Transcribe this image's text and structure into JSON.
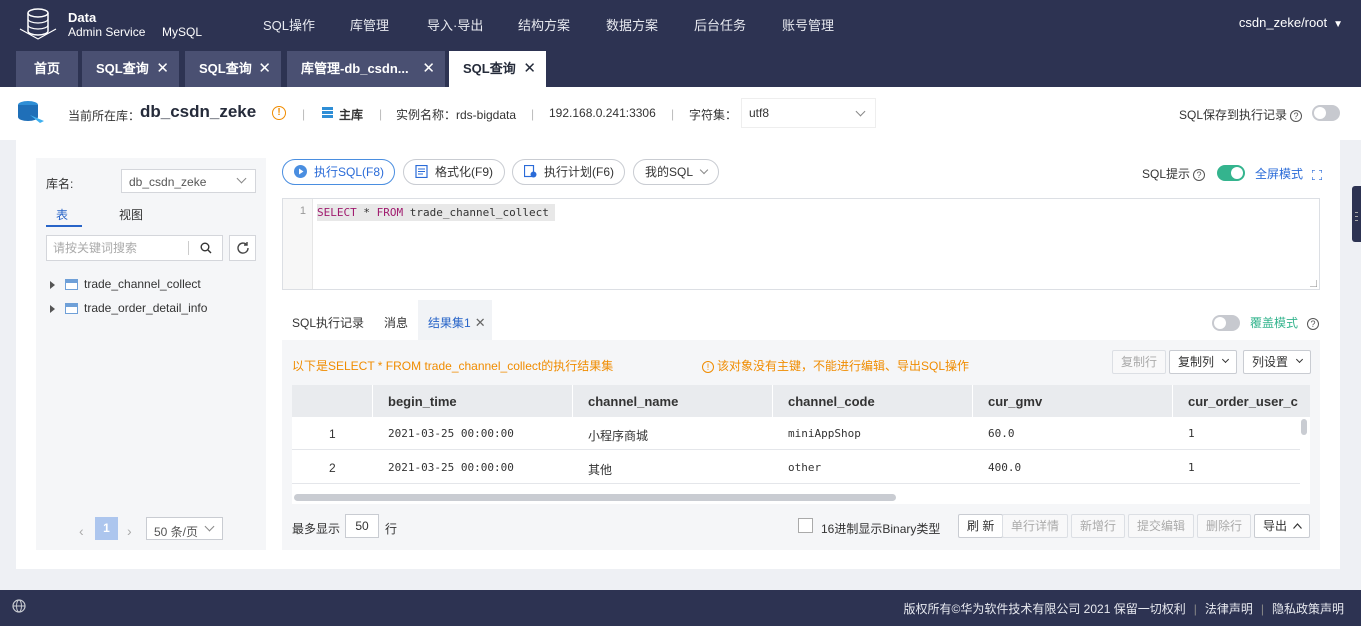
{
  "brand": {
    "line1": "Data",
    "line2": "Admin Service",
    "product": "MySQL"
  },
  "nav": {
    "items": [
      "SQL操作",
      "库管理",
      "导入·导出",
      "结构方案",
      "数据方案",
      "后台任务",
      "账号管理"
    ],
    "user": "csdn_zeke/root"
  },
  "tabs": [
    {
      "label": "首页"
    },
    {
      "label": "SQL查询",
      "close": "✕"
    },
    {
      "label": "SQL查询",
      "close": "✕"
    },
    {
      "label": "库管理-db_csdn...",
      "close": "✕"
    },
    {
      "label": "SQL查询",
      "close": "✕"
    }
  ],
  "info": {
    "current_label": "当前所在库：",
    "db_name": "db_csdn_zeke",
    "role": "主库",
    "instance": "实例名称：rds-bigdata",
    "address": "192.168.0.241:3306",
    "charset_label": "字符集：",
    "charset_value": "utf8",
    "save_label": "SQL保存到执行记录"
  },
  "left": {
    "lib_label": "库名:",
    "lib_value": "db_csdn_zeke",
    "tab_tables": "表",
    "tab_views": "视图",
    "search_placeholder": "请按关键词搜索",
    "tables": [
      "trade_channel_collect",
      "trade_order_detail_info"
    ],
    "page": "1",
    "page_size": "50 条/页"
  },
  "toolbar": {
    "run": "执行SQL(F8)",
    "format": "格式化(F9)",
    "plan": "执行计划(F6)",
    "mysql": "我的SQL",
    "sql_tip": "SQL提示",
    "fullscreen": "全屏模式"
  },
  "editor": {
    "line": "1",
    "kw1": "SELECT",
    "mid": " * ",
    "kw2": "FROM",
    "rest": " trade_channel_collect"
  },
  "result_tabs": {
    "history": "SQL执行记录",
    "messages": "消息",
    "result": "结果集1",
    "cover": "覆盖模式"
  },
  "result": {
    "message": "以下是SELECT * FROM trade_channel_collect的执行结果集",
    "warning": "该对象没有主键，不能进行编辑、导出SQL操作",
    "btn_copy_row": "复制行",
    "btn_copy_col": "复制列",
    "btn_col_settings": "列设置",
    "columns": [
      "begin_time",
      "channel_name",
      "channel_code",
      "cur_gmv",
      "cur_order_user_c"
    ],
    "rows": [
      {
        "n": "1",
        "begin_time": "2021-03-25 00:00:00",
        "channel_name": "小程序商城",
        "channel_code": "miniAppShop",
        "cur_gmv": "60.0",
        "cur_order_user": "1"
      },
      {
        "n": "2",
        "begin_time": "2021-03-25 00:00:00",
        "channel_name": "其他",
        "channel_code": "other",
        "cur_gmv": "400.0",
        "cur_order_user": "1"
      }
    ],
    "max_show": "最多显示",
    "max_value": "50",
    "row_unit": "行",
    "hex_label": "16进制显示Binary类型",
    "btn_refresh": "刷 新",
    "btn_row_detail": "单行详情",
    "btn_new_row": "新增行",
    "btn_submit": "提交编辑",
    "btn_delete": "删除行",
    "btn_export": "导出"
  },
  "footer": {
    "copyright": "版权所有©华为软件技术有限公司 2021 保留一切权利",
    "legal": "法律声明",
    "privacy": "隐私政策声明"
  },
  "colors": {
    "nav": "#2d3352",
    "accent": "#2864c8",
    "green": "#34b48e",
    "warn": "#f08c00"
  }
}
